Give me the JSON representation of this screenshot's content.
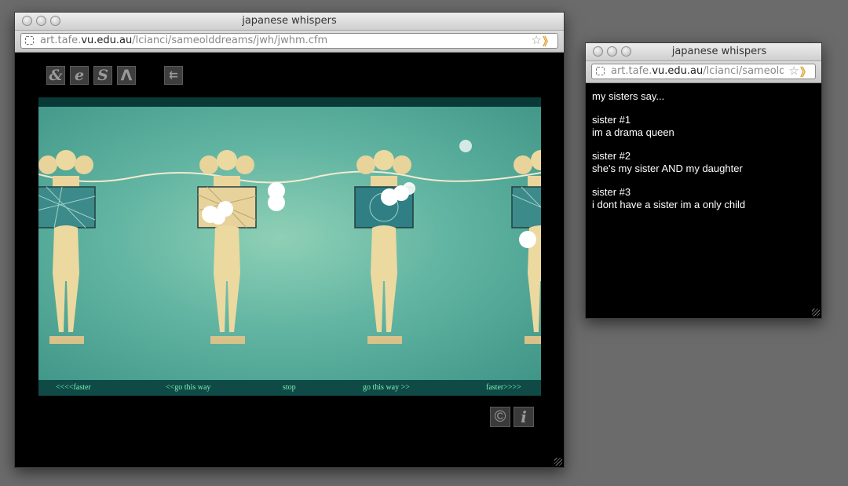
{
  "main_window": {
    "title": "japanese whispers",
    "url_prefix": "art.tafe.",
    "url_domain": "vu.edu.au",
    "url_suffix": "/lcianci/sameolddreams/jwh/jwhm.cfm",
    "nav_icons": [
      "&",
      "e",
      "S",
      "Λ",
      "⇇"
    ],
    "controls": {
      "faster_back": "<<<<faster",
      "go_back": "<<go this way",
      "stop": "stop",
      "go_forward": "go this way >>",
      "faster_forward": "faster>>>>"
    },
    "corner_icons": {
      "copyright": "©",
      "info": "i"
    }
  },
  "popup_window": {
    "title": "japanese whispers",
    "url_prefix": "art.tafe.",
    "url_domain": "vu.edu.au",
    "url_suffix": "/lcianci/sameoldd",
    "heading": "my sisters say...",
    "sisters": [
      {
        "label": "sister #1",
        "quote": "im a drama queen"
      },
      {
        "label": "sister #2",
        "quote": "she's my sister AND my daughter"
      },
      {
        "label": "sister #3",
        "quote": "i dont have a sister im a only child"
      }
    ]
  },
  "colors": {
    "control_text": "#7cf0b4",
    "stage_border": "#0a3a38",
    "art_bg": "#62b5a2",
    "figure_skin": "#ecd9a0"
  }
}
